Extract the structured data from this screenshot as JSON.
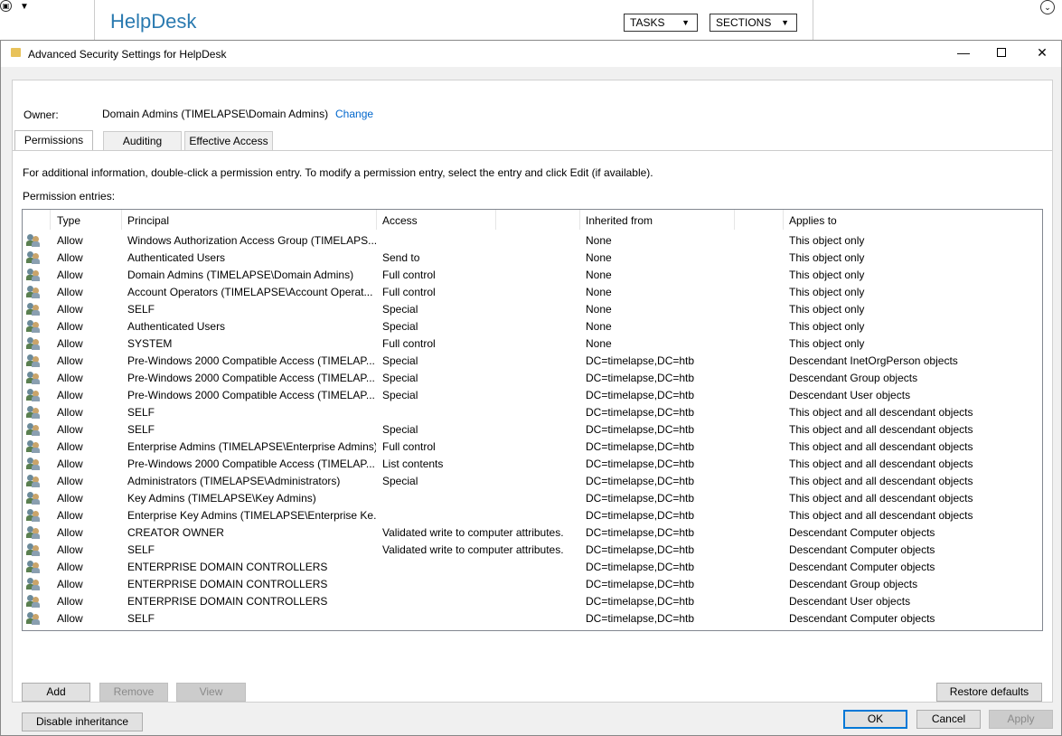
{
  "background_app": {
    "title": "HelpDesk",
    "tasks_label": "TASKS",
    "sections_label": "SECTIONS"
  },
  "dialog": {
    "title": "Advanced Security Settings for HelpDesk",
    "owner_label": "Owner:",
    "owner_value": "Domain Admins (TIMELAPSE\\Domain Admins)",
    "owner_change": "Change",
    "tabs": [
      {
        "label": "Permissions"
      },
      {
        "label": "Auditing"
      },
      {
        "label": "Effective Access"
      }
    ],
    "info_text": "For additional information, double-click a permission entry. To modify a permission entry, select the entry and click Edit (if available).",
    "entries_label": "Permission entries:",
    "columns": [
      "Type",
      "Principal",
      "Access",
      "Inherited from",
      "Applies to"
    ],
    "rows": [
      [
        "Allow",
        "Windows Authorization Access Group (TIMELAPS...",
        "",
        "None",
        "This object only"
      ],
      [
        "Allow",
        "Authenticated Users",
        "Send to",
        "None",
        "This object only"
      ],
      [
        "Allow",
        "Domain Admins (TIMELAPSE\\Domain Admins)",
        "Full control",
        "None",
        "This object only"
      ],
      [
        "Allow",
        "Account Operators (TIMELAPSE\\Account Operat...",
        "Full control",
        "None",
        "This object only"
      ],
      [
        "Allow",
        "SELF",
        "Special",
        "None",
        "This object only"
      ],
      [
        "Allow",
        "Authenticated Users",
        "Special",
        "None",
        "This object only"
      ],
      [
        "Allow",
        "SYSTEM",
        "Full control",
        "None",
        "This object only"
      ],
      [
        "Allow",
        "Pre-Windows 2000 Compatible Access (TIMELAP...",
        "Special",
        "DC=timelapse,DC=htb",
        "Descendant InetOrgPerson objects"
      ],
      [
        "Allow",
        "Pre-Windows 2000 Compatible Access (TIMELAP...",
        "Special",
        "DC=timelapse,DC=htb",
        "Descendant Group objects"
      ],
      [
        "Allow",
        "Pre-Windows 2000 Compatible Access (TIMELAP...",
        "Special",
        "DC=timelapse,DC=htb",
        "Descendant User objects"
      ],
      [
        "Allow",
        "SELF",
        "",
        "DC=timelapse,DC=htb",
        "This object and all descendant objects"
      ],
      [
        "Allow",
        "SELF",
        "Special",
        "DC=timelapse,DC=htb",
        "This object and all descendant objects"
      ],
      [
        "Allow",
        "Enterprise Admins (TIMELAPSE\\Enterprise Admins)",
        "Full control",
        "DC=timelapse,DC=htb",
        "This object and all descendant objects"
      ],
      [
        "Allow",
        "Pre-Windows 2000 Compatible Access (TIMELAP...",
        "List contents",
        "DC=timelapse,DC=htb",
        "This object and all descendant objects"
      ],
      [
        "Allow",
        "Administrators (TIMELAPSE\\Administrators)",
        "Special",
        "DC=timelapse,DC=htb",
        "This object and all descendant objects"
      ],
      [
        "Allow",
        "Key Admins (TIMELAPSE\\Key Admins)",
        "",
        "DC=timelapse,DC=htb",
        "This object and all descendant objects"
      ],
      [
        "Allow",
        "Enterprise Key Admins (TIMELAPSE\\Enterprise Ke...",
        "",
        "DC=timelapse,DC=htb",
        "This object and all descendant objects"
      ],
      [
        "Allow",
        "CREATOR OWNER",
        "Validated write to computer attributes.",
        "DC=timelapse,DC=htb",
        "Descendant Computer objects"
      ],
      [
        "Allow",
        "SELF",
        "Validated write to computer attributes.",
        "DC=timelapse,DC=htb",
        "Descendant Computer objects"
      ],
      [
        "Allow",
        "ENTERPRISE DOMAIN CONTROLLERS",
        "",
        "DC=timelapse,DC=htb",
        "Descendant Computer objects"
      ],
      [
        "Allow",
        "ENTERPRISE DOMAIN CONTROLLERS",
        "",
        "DC=timelapse,DC=htb",
        "Descendant Group objects"
      ],
      [
        "Allow",
        "ENTERPRISE DOMAIN CONTROLLERS",
        "",
        "DC=timelapse,DC=htb",
        "Descendant User objects"
      ],
      [
        "Allow",
        "SELF",
        "",
        "DC=timelapse,DC=htb",
        "Descendant Computer objects"
      ]
    ],
    "buttons": {
      "add": "Add",
      "remove": "Remove",
      "view": "View",
      "restore_defaults": "Restore defaults",
      "disable_inheritance": "Disable inheritance",
      "ok": "OK",
      "cancel": "Cancel",
      "apply": "Apply"
    }
  }
}
